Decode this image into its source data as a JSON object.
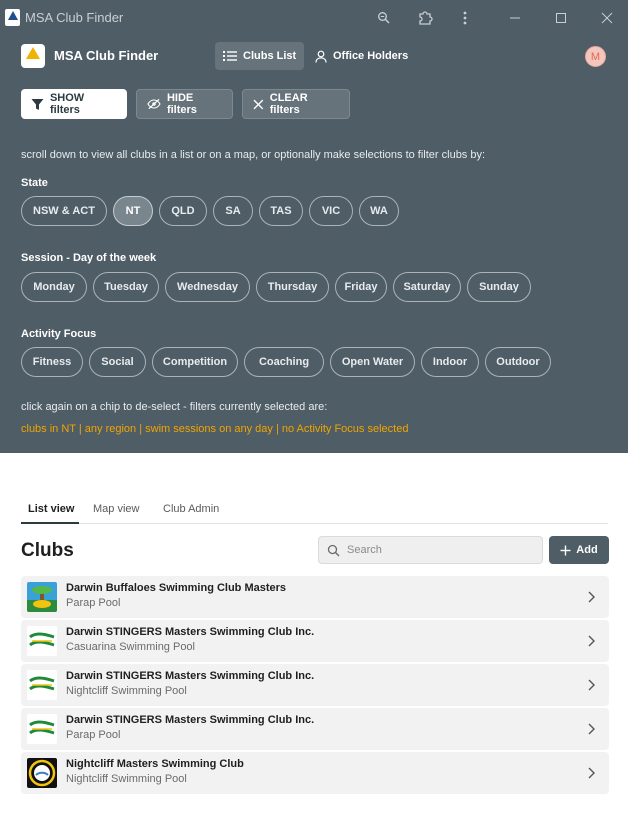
{
  "window": {
    "title": "MSA Club Finder"
  },
  "nav": {
    "app_title": "MSA Club Finder",
    "tabs": [
      {
        "label": "Clubs List",
        "icon": "list-icon",
        "active": true
      },
      {
        "label": "Office Holders",
        "icon": "person-icon",
        "active": false
      }
    ],
    "avatar_initial": "M"
  },
  "filter_buttons": {
    "show": "SHOW filters",
    "hide": "HIDE filters",
    "clear": "CLEAR filters"
  },
  "instruction": "scroll down to view all clubs in a list or on a map, or optionally make selections to filter clubs by:",
  "filters": {
    "state": {
      "label": "State",
      "chips": [
        {
          "label": "NSW & ACT",
          "selected": false
        },
        {
          "label": "NT",
          "selected": true
        },
        {
          "label": "QLD",
          "selected": false
        },
        {
          "label": "SA",
          "selected": false
        },
        {
          "label": "TAS",
          "selected": false
        },
        {
          "label": "VIC",
          "selected": false
        },
        {
          "label": "WA",
          "selected": false
        }
      ]
    },
    "session": {
      "label": "Session - Day of the week",
      "chips": [
        {
          "label": "Monday",
          "selected": false
        },
        {
          "label": "Tuesday",
          "selected": false
        },
        {
          "label": "Wednesday",
          "selected": false
        },
        {
          "label": "Thursday",
          "selected": false
        },
        {
          "label": "Friday",
          "selected": false
        },
        {
          "label": "Saturday",
          "selected": false
        },
        {
          "label": "Sunday",
          "selected": false
        }
      ]
    },
    "activity": {
      "label": "Activity Focus",
      "chips": [
        {
          "label": "Fitness",
          "selected": false
        },
        {
          "label": "Social",
          "selected": false
        },
        {
          "label": "Competition",
          "selected": false
        },
        {
          "label": "Coaching",
          "selected": false
        },
        {
          "label": "Open Water",
          "selected": false
        },
        {
          "label": "Indoor",
          "selected": false
        },
        {
          "label": "Outdoor",
          "selected": false
        }
      ]
    }
  },
  "deselect_note": "click again on a chip to de-select - filters currently selected are:",
  "selected_summary": "clubs in NT | any region | swim sessions on any day | no Activity Focus selected",
  "view_tabs": [
    {
      "label": "List view",
      "active": true
    },
    {
      "label": "Map view",
      "active": false
    },
    {
      "label": "Club Admin",
      "active": false
    }
  ],
  "clubs": {
    "heading": "Clubs",
    "search_placeholder": "Search",
    "add_label": "Add",
    "items": [
      {
        "name": "Darwin Buffaloes Swimming Club Masters",
        "venue": "Parap Pool",
        "logo": "buffaloes-logo"
      },
      {
        "name": "Darwin STINGERS Masters Swimming Club Inc.",
        "venue": "Casuarina Swimming Pool",
        "logo": "stingers-logo"
      },
      {
        "name": "Darwin STINGERS Masters Swimming Club Inc.",
        "venue": "Nightcliff Swimming Pool",
        "logo": "stingers-logo"
      },
      {
        "name": "Darwin STINGERS Masters Swimming Club Inc.",
        "venue": "Parap Pool",
        "logo": "stingers-logo"
      },
      {
        "name": "Nightcliff Masters Swimming Club",
        "venue": "Nightcliff Swimming Pool",
        "logo": "nightcliff-logo"
      }
    ]
  },
  "colors": {
    "panel": "#4f5d66",
    "accent": "#f0a500",
    "primary_button": "#4f5d66"
  }
}
